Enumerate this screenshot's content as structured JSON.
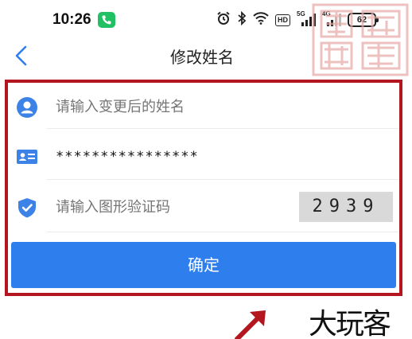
{
  "status_bar": {
    "time": "10:26",
    "hd_label": "HD",
    "signal1_tag": "5G",
    "signal2_tag": "4G",
    "battery": "62"
  },
  "header": {
    "title": "修改姓名"
  },
  "form": {
    "name_placeholder": "请输入变更后的姓名",
    "id_value": "****************",
    "captcha_placeholder": "请输入图形验证码",
    "captcha_code": "2939",
    "confirm_label": "确定"
  },
  "colors": {
    "accent": "#2f7eee",
    "highlight_border": "#b3161e"
  },
  "watermark": "大玩客"
}
